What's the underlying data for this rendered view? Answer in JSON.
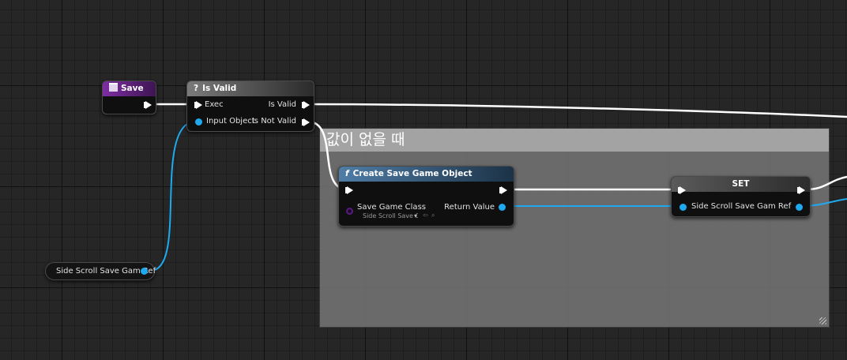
{
  "comment": {
    "title": "값이 없을 때"
  },
  "nodes": {
    "save": {
      "title": "Save"
    },
    "is_valid": {
      "title": "Is Valid",
      "glyph": "?",
      "pins": {
        "exec": "Exec",
        "input_object": "Input Object",
        "is_valid": "Is Valid",
        "is_not_valid": "Is Not Valid"
      }
    },
    "create_save_game_object": {
      "title": "Create Save Game Object",
      "glyph": "f",
      "pins": {
        "save_game_class": "Save Game Class",
        "save_game_class_value": "Side Scroll Save G",
        "return_value": "Return Value"
      }
    },
    "set": {
      "title": "SET",
      "pins": {
        "side_scroll_save_gam_ref": "Side Scroll Save Gam Ref"
      }
    },
    "variable_get": {
      "label": "Side Scroll Save Gam Ref"
    }
  },
  "colors": {
    "exec_wire": "#ffffff",
    "object_wire": "#1fa9ef",
    "class_pin": "#5a1a82",
    "event_header": "#7d2ea3",
    "function_header": "#4f7da7"
  }
}
